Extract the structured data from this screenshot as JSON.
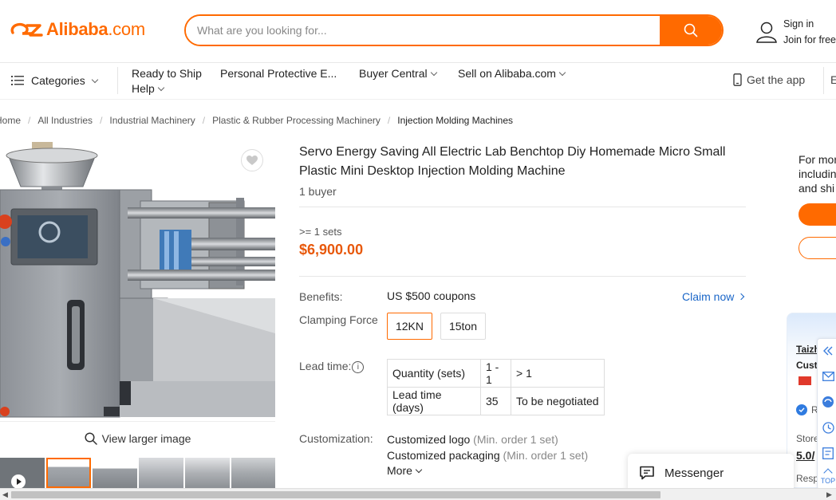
{
  "header": {
    "logo_text": "Alibaba",
    "logo_suffix": ".com",
    "search_placeholder": "What are you looking for...",
    "signin": "Sign in",
    "join": "Join for free"
  },
  "nav": {
    "categories": "Categories",
    "ready_to_ship": "Ready to Ship",
    "help": "Help",
    "ppe": "Personal Protective E...",
    "buyer_central": "Buyer Central",
    "sell": "Sell on Alibaba.com",
    "get_app": "Get the app",
    "edge_letter": "E"
  },
  "breadcrumb": [
    "Home",
    "All Industries",
    "Industrial Machinery",
    "Plastic & Rubber Processing Machinery",
    "Injection Molding Machines"
  ],
  "gallery": {
    "view_larger": "View larger image"
  },
  "product": {
    "title": "Servo Energy Saving All Electric Lab Benchtop Diy Homemade Micro Small Plastic Mini Desktop Injection Molding Machine",
    "buyers": "1 buyer",
    "moq": ">= 1 sets",
    "price": "$6,900.00",
    "benefits_label": "Benefits:",
    "benefits_value": "US $500 coupons",
    "claim_now": "Claim now",
    "clamping_label": "Clamping Force",
    "clamping_options": [
      "12KN",
      "15ton"
    ],
    "lead_label": "Lead time:",
    "lead_table": {
      "row1": [
        "Quantity (sets)",
        "1 - 1",
        "> 1"
      ],
      "row2": [
        "Lead time (days)",
        "35",
        "To be negotiated"
      ]
    },
    "customization_label": "Customization:",
    "custom_logo": "Customized logo",
    "custom_logo_note": "(Min. order 1 set)",
    "custom_pack": "Customized packaging",
    "custom_pack_note": "(Min. order 1 set)",
    "more": "More"
  },
  "right_panel": {
    "line1": "For mor",
    "line2": "includin",
    "line3": "and shi",
    "supplier_name": "Taizh",
    "supplier_sub": "Custo",
    "verified_letter": "R",
    "store_label": "Store",
    "rating": "5.0/",
    "resp": "Resp"
  },
  "toolbar": {
    "top": "TOP"
  },
  "messenger": {
    "label": "Messenger"
  },
  "colors": {
    "brand": "#ff6a00",
    "price": "#e8590c",
    "link": "#1a66c8"
  }
}
